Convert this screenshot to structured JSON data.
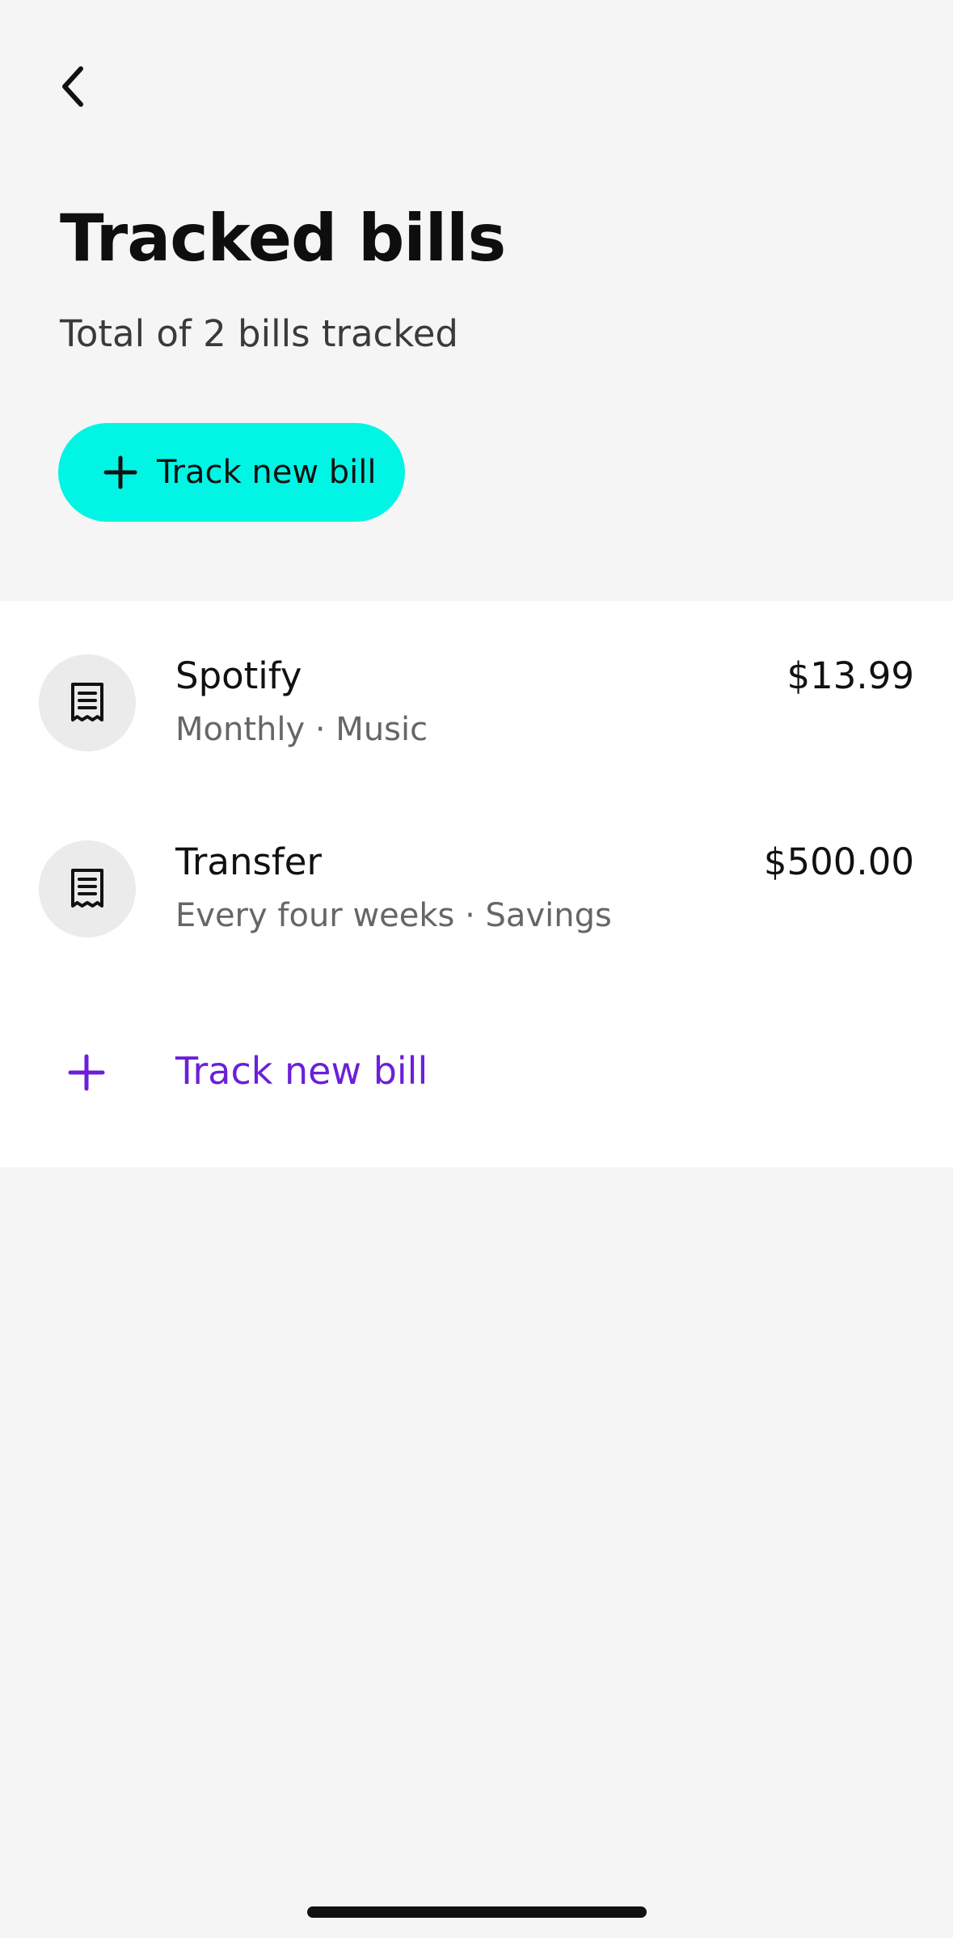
{
  "colors": {
    "accent": "#00f5e4",
    "link": "#6b1fd8"
  },
  "header": {
    "back_icon": "chevron-left-icon",
    "title": "Tracked bills",
    "subtitle": "Total of 2 bills tracked",
    "track_button_label": "Track new bill",
    "track_button_icon": "plus-icon"
  },
  "bills": [
    {
      "name": "Spotify",
      "detail": "Monthly · Music",
      "amount": "$13.99",
      "icon": "receipt-icon"
    },
    {
      "name": "Transfer",
      "detail": "Every four weeks · Savings",
      "amount": "$500.00",
      "icon": "receipt-icon"
    }
  ],
  "footer_action": {
    "label": "Track new bill",
    "icon": "plus-icon"
  }
}
